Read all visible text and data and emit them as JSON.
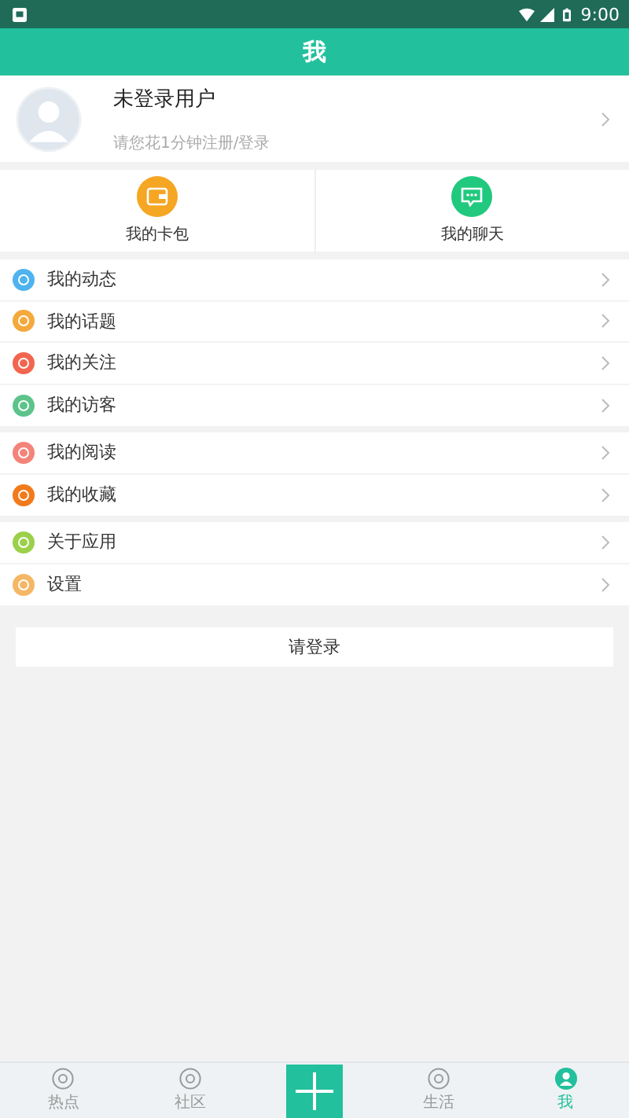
{
  "status_bar": {
    "time": "9:00"
  },
  "header": {
    "title": "我"
  },
  "profile": {
    "name": "未登录用户",
    "hint": "请您花1分钟注册/登录"
  },
  "shortcuts": [
    {
      "kind": "wallet",
      "label": "我的卡包",
      "color": "#f5a623"
    },
    {
      "kind": "chat",
      "label": "我的聊天",
      "color": "#21c97e"
    }
  ],
  "menu_groups": [
    {
      "items": [
        {
          "label": "我的动态",
          "color": "#4eb3ee"
        },
        {
          "label": "我的话题",
          "color": "#f3a93c"
        },
        {
          "label": "我的关注",
          "color": "#f2654f"
        },
        {
          "label": "我的访客",
          "color": "#5cc48a"
        }
      ]
    },
    {
      "items": [
        {
          "label": "我的阅读",
          "color": "#f4837a"
        },
        {
          "label": "我的收藏",
          "color": "#f27a1a"
        }
      ]
    },
    {
      "items": [
        {
          "label": "关于应用",
          "color": "#9bd04a"
        },
        {
          "label": "设置",
          "color": "#f5b766"
        }
      ]
    }
  ],
  "login_button": "请登录",
  "tabs": [
    {
      "kind": "tab",
      "label": "热点",
      "selected": false
    },
    {
      "kind": "tab",
      "label": "社区",
      "selected": false
    },
    {
      "kind": "add"
    },
    {
      "kind": "tab",
      "label": "生活",
      "selected": false
    },
    {
      "kind": "tab",
      "label": "我",
      "selected": true
    }
  ]
}
